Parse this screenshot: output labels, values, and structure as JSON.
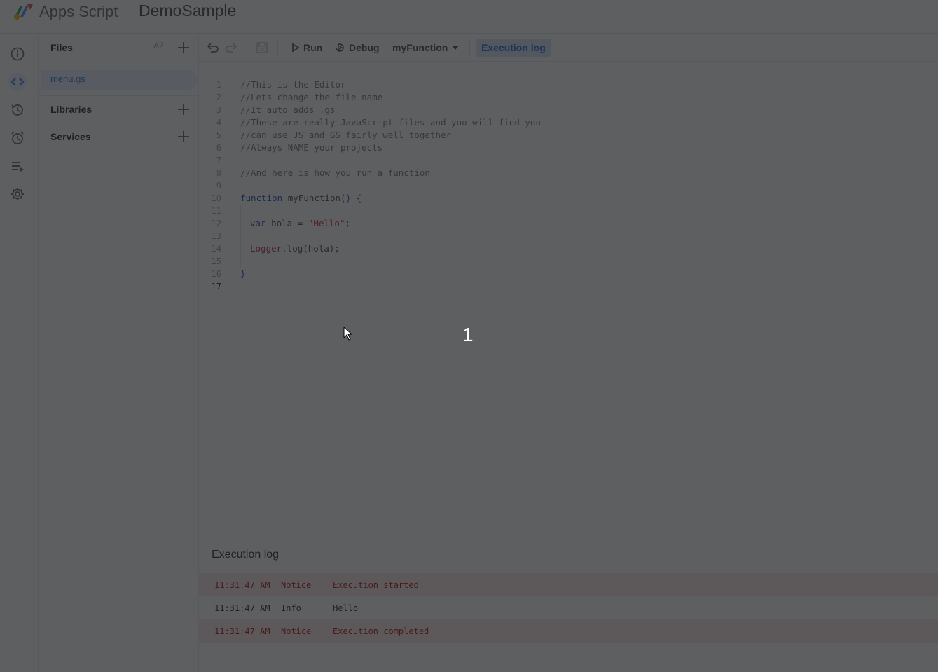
{
  "header": {
    "product_name": "Apps Script",
    "project_name": "DemoSample"
  },
  "rail": {
    "items": [
      {
        "icon": "info-icon",
        "name": "Overview"
      },
      {
        "icon": "code-icon",
        "name": "Editor",
        "active": true
      },
      {
        "icon": "history-icon",
        "name": "Project History"
      },
      {
        "icon": "alarm-icon",
        "name": "Triggers"
      },
      {
        "icon": "executions-icon",
        "name": "Executions"
      },
      {
        "icon": "gear-icon",
        "name": "Project Settings"
      }
    ]
  },
  "files_panel": {
    "title": "Files",
    "sort_label": "AZ",
    "files": [
      "menu.gs"
    ],
    "libraries_label": "Libraries",
    "services_label": "Services"
  },
  "toolbar": {
    "run_label": "Run",
    "debug_label": "Debug",
    "function_select": "myFunction",
    "execution_log_label": "Execution log"
  },
  "editor": {
    "line_numbers": [
      "1",
      "2",
      "3",
      "4",
      "5",
      "6",
      "7",
      "8",
      "9",
      "10",
      "11",
      "12",
      "13",
      "14",
      "15",
      "16",
      "17"
    ],
    "current_line": "17",
    "lines": {
      "l1": "//This is the Editor",
      "l2": "//Lets change the file name",
      "l3": "//It auto adds .gs",
      "l4": "//These are really JavaScript files and you will find you",
      "l5": "//can use JS and GS fairly well together",
      "l6": "//Always NAME your projects",
      "l8": "//And here is how you run a function",
      "l10_kw": "function",
      "l10_name": " myFunction",
      "l10_paren": "()",
      "l10_brace": " {",
      "l12_kw": "var",
      "l12_rest": " hola = ",
      "l12_str": "\"Hello\"",
      "l12_semi": ";",
      "l14_obj": "Logger",
      "l14_rest": ".log(hola);",
      "l16": "}"
    }
  },
  "execution_log": {
    "title": "Execution log",
    "rows": [
      {
        "time": "11:31:47 AM",
        "level": "Notice",
        "message": "Execution started"
      },
      {
        "time": "11:31:47 AM",
        "level": "Info",
        "message": "Hello"
      },
      {
        "time": "11:31:47 AM",
        "level": "Notice",
        "message": "Execution completed"
      }
    ]
  },
  "overlay": {
    "countdown": "1"
  },
  "colors": {
    "accent": "#1a73e8",
    "overlay": "#202124"
  }
}
